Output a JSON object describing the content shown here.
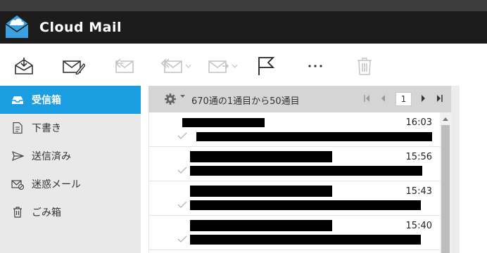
{
  "app": {
    "title": "Cloud Mail",
    "accent": "#1a9de1",
    "logo_color": "#3aa0e0"
  },
  "toolbar": {
    "buttons": [
      {
        "name": "receive-icon",
        "enabled": true
      },
      {
        "name": "compose-icon",
        "enabled": true
      },
      {
        "name": "reply-icon",
        "enabled": false
      },
      {
        "name": "reply-all-icon",
        "enabled": false,
        "dropdown": true
      },
      {
        "name": "forward-icon",
        "enabled": false,
        "dropdown": true
      },
      {
        "name": "flag-icon",
        "enabled": true
      },
      {
        "name": "more-icon",
        "enabled": true
      },
      {
        "name": "trash-icon",
        "enabled": false
      }
    ]
  },
  "sidebar": {
    "items": [
      {
        "label": "受信箱",
        "icon": "inbox-icon",
        "active": true
      },
      {
        "label": "下書き",
        "icon": "draft-icon",
        "active": false
      },
      {
        "label": "送信済み",
        "icon": "sent-icon",
        "active": false
      },
      {
        "label": "迷惑メール",
        "icon": "spam-icon",
        "active": false
      },
      {
        "label": "ごみ箱",
        "icon": "trash-icon",
        "active": false
      }
    ]
  },
  "list": {
    "count_text": "670通の1通目から50通目",
    "page": "1",
    "messages": [
      {
        "time": "16:03",
        "read": true
      },
      {
        "time": "15:56",
        "read": true
      },
      {
        "time": "15:43",
        "read": true
      },
      {
        "time": "15:40",
        "read": true
      }
    ]
  }
}
